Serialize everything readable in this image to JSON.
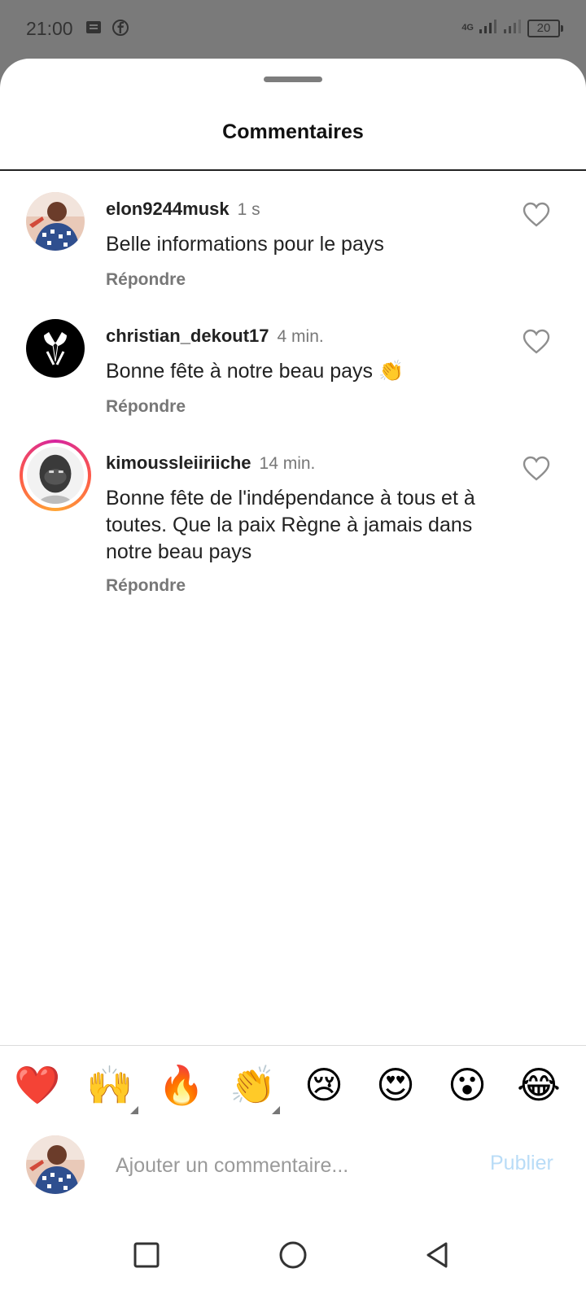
{
  "status": {
    "time": "21:00",
    "network": "4G",
    "battery": "20"
  },
  "sheet": {
    "title": "Commentaires"
  },
  "comments": [
    {
      "username": "elon9244musk",
      "time": "1 s",
      "text": "Belle informations pour le pays",
      "reply_label": "Répondre"
    },
    {
      "username": "christian_dekout17",
      "time": "4 min.",
      "text": "Bonne fête à notre beau pays 👏",
      "reply_label": "Répondre"
    },
    {
      "username": "kimoussleiiriiche",
      "time": "14 min.",
      "text": "Bonne fête de l'indépendance à tous et à toutes. Que la paix Règne à jamais dans notre beau pays",
      "reply_label": "Répondre"
    }
  ],
  "quick_reactions": [
    "❤️",
    "🙌",
    "🔥",
    "👏",
    "😢",
    "😍",
    "😮",
    "😂"
  ],
  "composer": {
    "placeholder": "Ajouter un commentaire...",
    "publish_label": "Publier"
  },
  "colors": {
    "publish_disabled": "#b9dcf7",
    "story_ring": "#d6249f"
  }
}
